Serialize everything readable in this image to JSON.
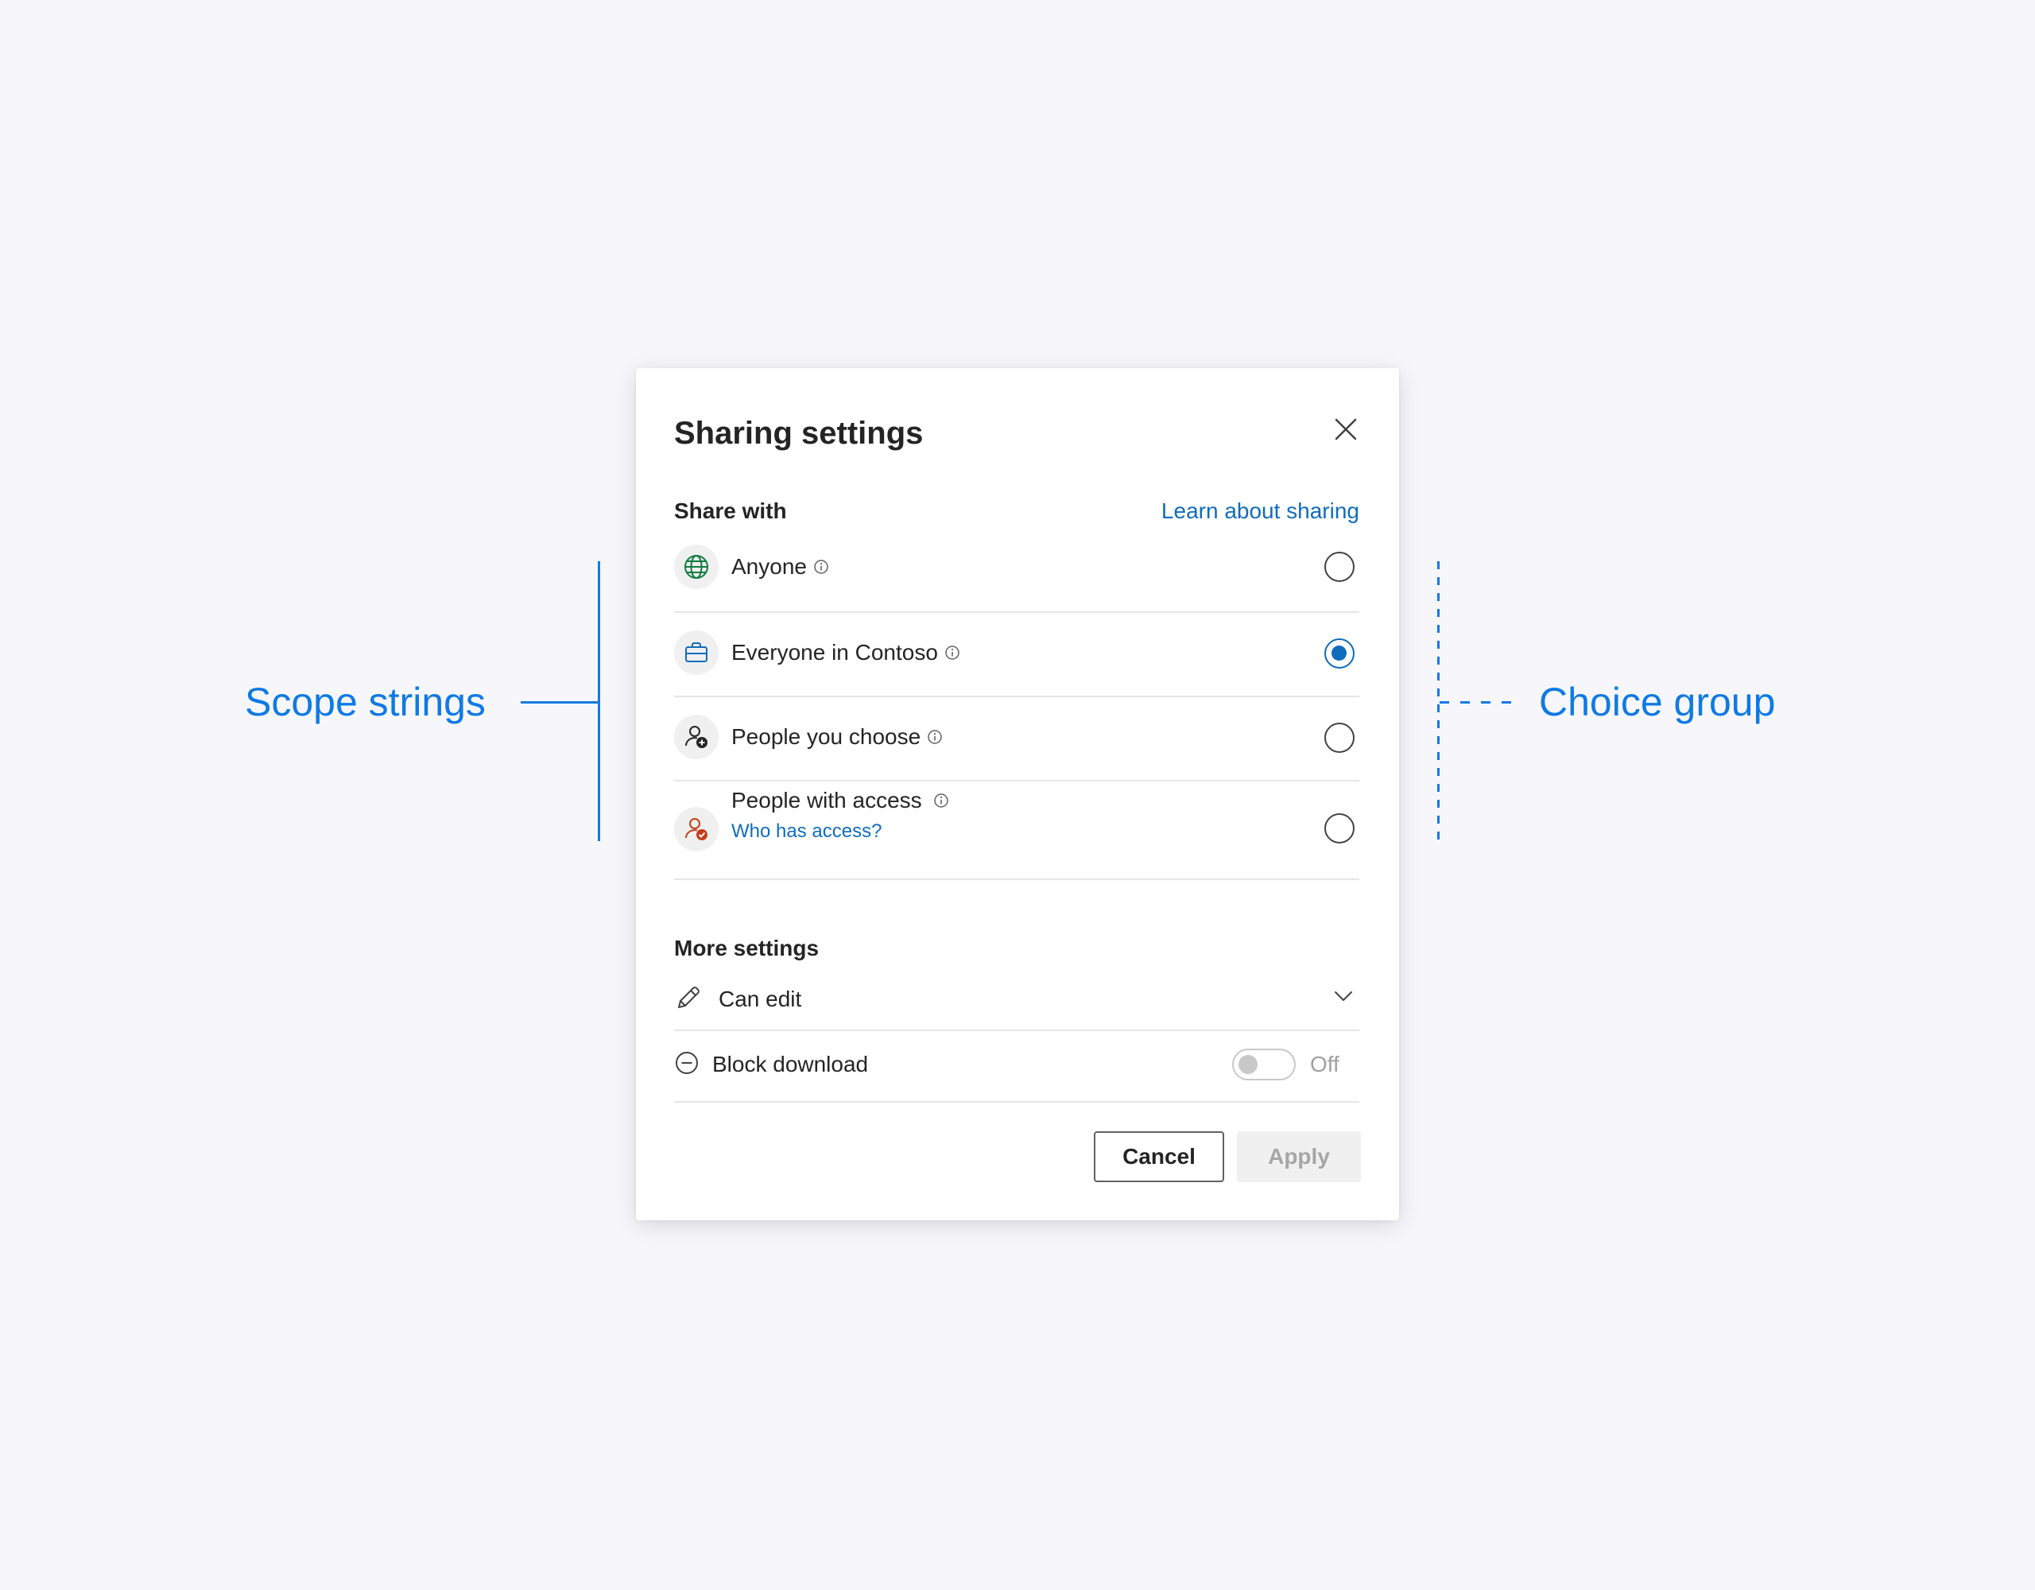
{
  "annotations": {
    "scope_strings": "Scope strings",
    "choice_group": "Choice group",
    "color": "#0f7ae5"
  },
  "dialog": {
    "title": "Sharing settings",
    "close_icon": "close-icon",
    "share_with_label": "Share with",
    "learn_link": "Learn about sharing",
    "options": [
      {
        "label": "Anyone",
        "icon": "globe-icon",
        "icon_color": "#107c41",
        "selected": false
      },
      {
        "label": "Everyone in Contoso",
        "icon": "briefcase-icon",
        "icon_color": "#0f6cbd",
        "selected": true
      },
      {
        "label": "People you choose",
        "icon": "person-add-icon",
        "icon_color": "#242424",
        "selected": false
      },
      {
        "label": "People with access",
        "icon": "person-check-icon",
        "icon_color": "#c43e1c",
        "selected": false,
        "sublink": "Who has access?"
      }
    ],
    "more_settings_label": "More settings",
    "permission": {
      "value": "Can edit",
      "icon": "pencil-icon"
    },
    "block_download": {
      "label": "Block download",
      "icon": "minus-circle-icon",
      "state": "Off",
      "on": false
    },
    "buttons": {
      "cancel": "Cancel",
      "apply": "Apply"
    },
    "colors": {
      "accent": "#0f6cbd",
      "text": "#242424",
      "disabled_text": "#a6a6a6"
    }
  }
}
